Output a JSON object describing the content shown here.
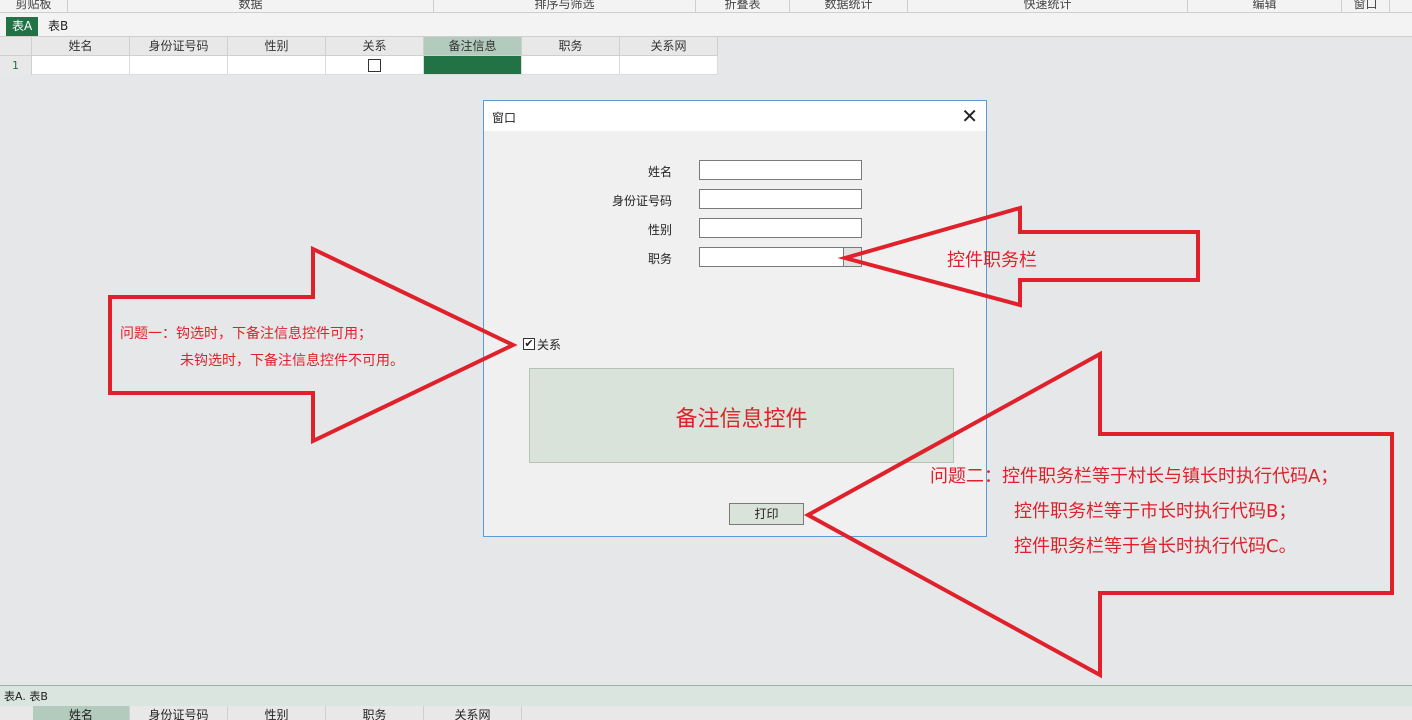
{
  "ribbon": {
    "groups": [
      "剪贴板",
      "数据",
      "排序与筛选",
      "折叠表",
      "数据统计",
      "快速统计",
      "编辑",
      "窗口"
    ]
  },
  "sheet_tabs": [
    "表A",
    "表B"
  ],
  "grid": {
    "columns": [
      "姓名",
      "身份证号码",
      "性别",
      "关系",
      "备注信息",
      "职务",
      "关系网"
    ],
    "selected_column": "备注信息",
    "rows": [
      {
        "num": "1",
        "cells": [
          "",
          "",
          "",
          "checkbox-unchecked",
          "",
          "",
          ""
        ]
      }
    ]
  },
  "dialog": {
    "title": "窗口",
    "close_glyph": "✕",
    "fields": [
      {
        "label": "姓名",
        "value": ""
      },
      {
        "label": "身份证号码",
        "value": ""
      },
      {
        "label": "性别",
        "value": ""
      },
      {
        "label": "职务",
        "value": "",
        "type": "combo"
      }
    ],
    "checkbox": {
      "label": "关系",
      "checked": true,
      "glyph": "✔"
    },
    "remark_text": "备注信息控件",
    "print_button": "打印"
  },
  "annotations": {
    "combo_note": "控件职务栏",
    "question1": [
      "问题一：钩选时，下备注信息控件可用；",
      "未钩选时，下备注信息控件不可用。"
    ],
    "question2": [
      "问题二：控件职务栏等于村长与镇长时执行代码A；",
      "控件职务栏等于市长时执行代码B；",
      "控件职务栏等于省长时执行代码C。"
    ],
    "arrow_color": "#e0212b"
  },
  "bottom": {
    "bar_text": "表A. 表B",
    "columns": [
      "姓名",
      "身份证号码",
      "性别",
      "职务",
      "关系网"
    ],
    "selected_column": "姓名"
  }
}
